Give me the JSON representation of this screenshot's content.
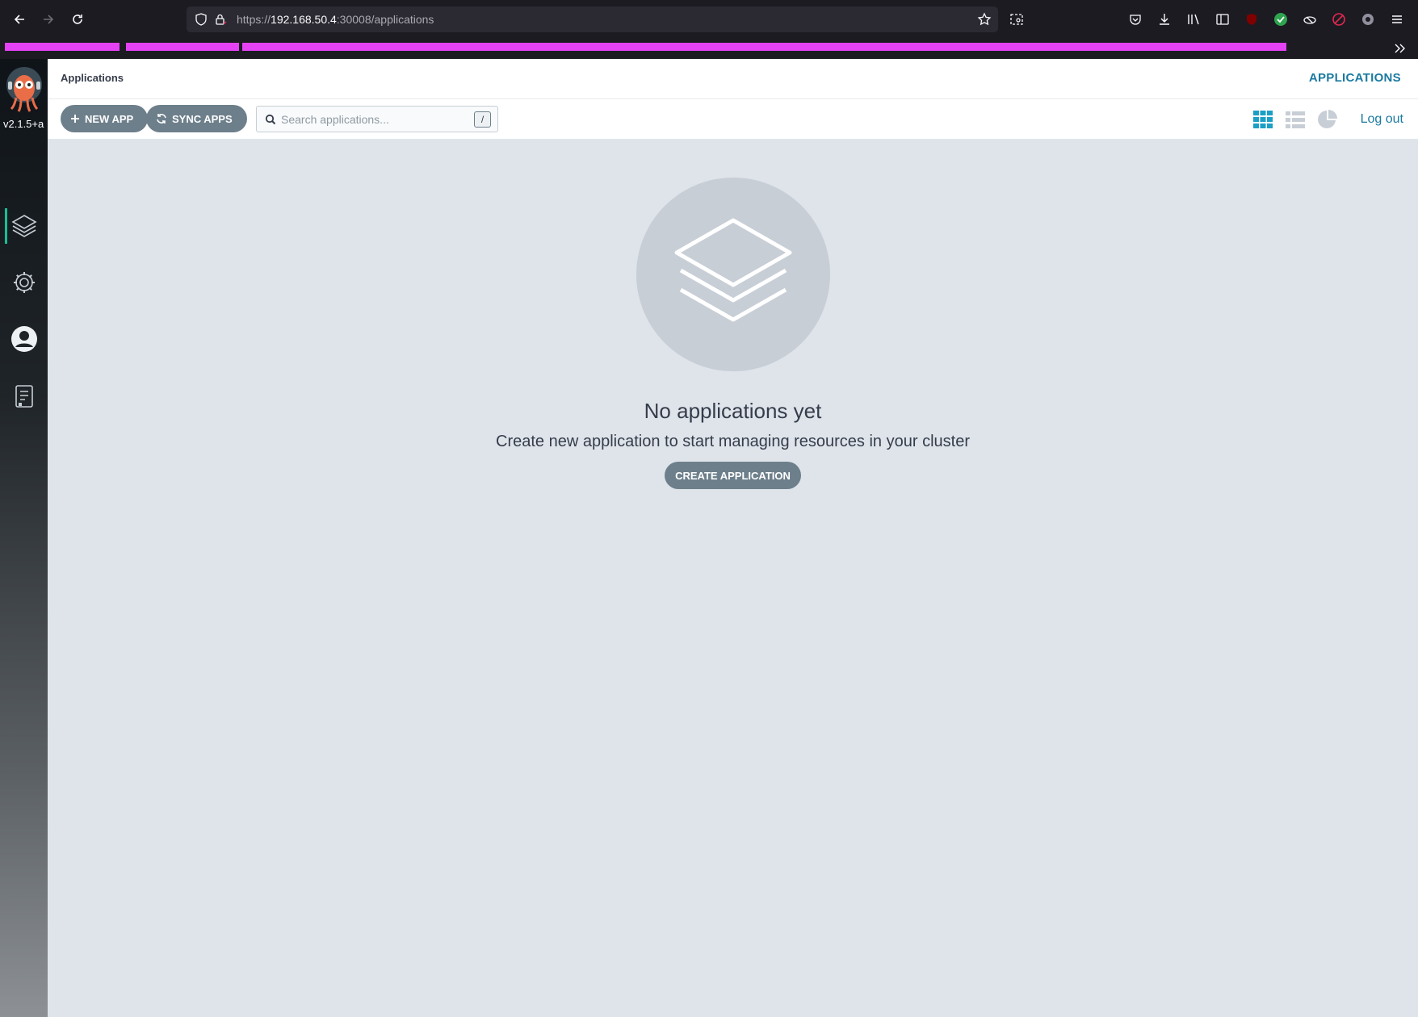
{
  "browser": {
    "url_scheme": "https://",
    "url_host": "192.168.50.4",
    "url_path": ":30008/applications"
  },
  "app": {
    "version": "v2.1.5+a",
    "breadcrumb": "Applications",
    "page_title": "APPLICATIONS",
    "sidebar_items": [
      {
        "name": "applications",
        "icon": "layers-icon",
        "active": true
      },
      {
        "name": "settings",
        "icon": "gear-icon",
        "active": false
      },
      {
        "name": "user-info",
        "icon": "user-icon",
        "active": false
      },
      {
        "name": "documentation",
        "icon": "docs-icon",
        "active": false
      }
    ],
    "toolbar": {
      "new_app_label": "NEW APP",
      "sync_apps_label": "SYNC APPS",
      "search_placeholder": "Search applications...",
      "search_shortcut": "/",
      "logout_label": "Log out"
    },
    "empty_state": {
      "title": "No applications yet",
      "subtitle": "Create new application to start managing resources in your cluster",
      "button_label": "CREATE APPLICATION"
    }
  },
  "colors": {
    "accent": "#1b7aa0",
    "button": "#6d7f8b",
    "content_bg": "#dee4ea",
    "bookmark_redaction": "#e542f5"
  }
}
